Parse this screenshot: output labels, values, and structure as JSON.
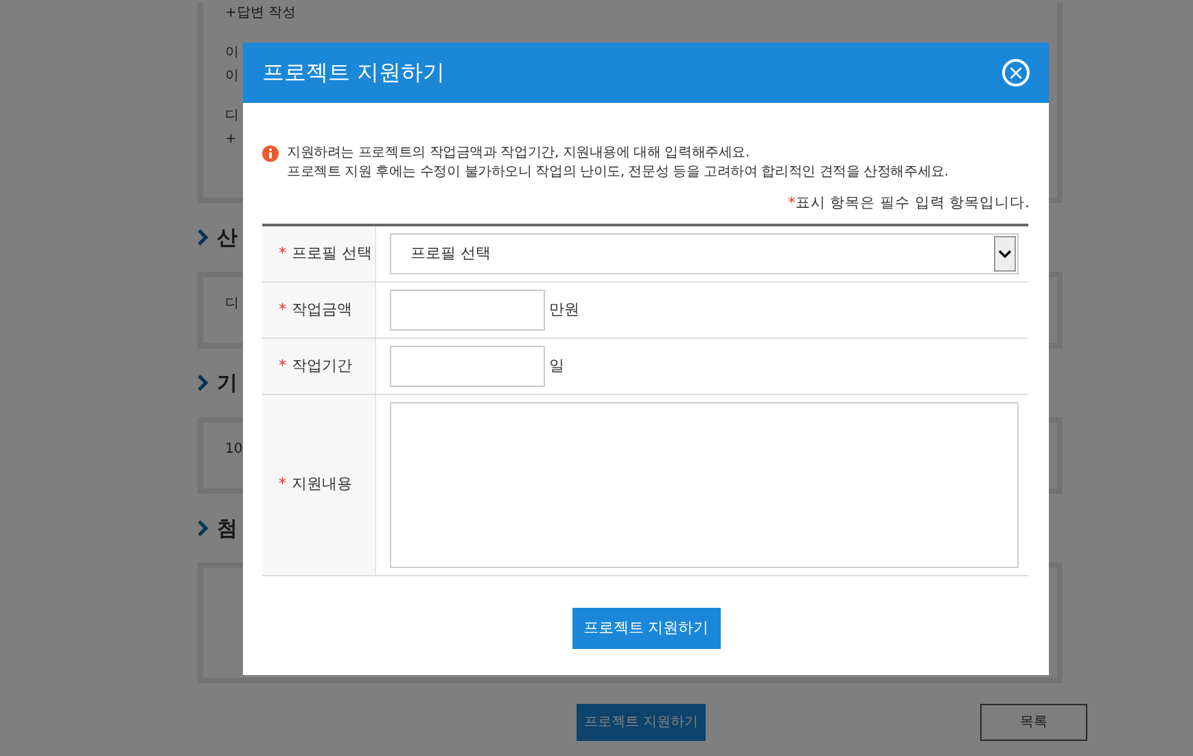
{
  "background_page": {
    "answer_box": {
      "lines": [
        "+답변 작성",
        "이",
        "이",
        "디",
        "+"
      ]
    },
    "sections": [
      {
        "heading": "산",
        "lines": [
          "디"
        ]
      },
      {
        "heading": "기",
        "lines": [
          "10"
        ]
      },
      {
        "heading": "첨"
      }
    ],
    "buttons": [
      {
        "label": "프로젝트 지원하기",
        "kind": "primary"
      },
      {
        "label": "목록",
        "kind": "outline"
      }
    ]
  },
  "modal": {
    "title": "프로젝트 지원하기",
    "close": "×",
    "notice": [
      "지원하려는 프로젝트의 작업금액과 작업기간, 지원내용에 대해 입력해주세요.",
      "프로젝트 지원 후에는 수정이 불가하오니 작업의 난이도, 전문성 등을 고려하여 합리적인 견적을 산정해주세요."
    ],
    "required_note": {
      "mark": "*",
      "text": "표시 항목은 필수 입력 항목입니다."
    },
    "fields": [
      {
        "label": "프로필 선택",
        "required": true,
        "kind": "select",
        "value": "프로필 선택"
      },
      {
        "label": "작업금액",
        "required": true,
        "kind": "text",
        "unit": "만원"
      },
      {
        "label": "작업기간",
        "required": true,
        "kind": "text",
        "unit": "일"
      },
      {
        "label": "지원내용",
        "required": true,
        "kind": "textarea"
      }
    ],
    "submit": "프로젝트 지원하기"
  }
}
